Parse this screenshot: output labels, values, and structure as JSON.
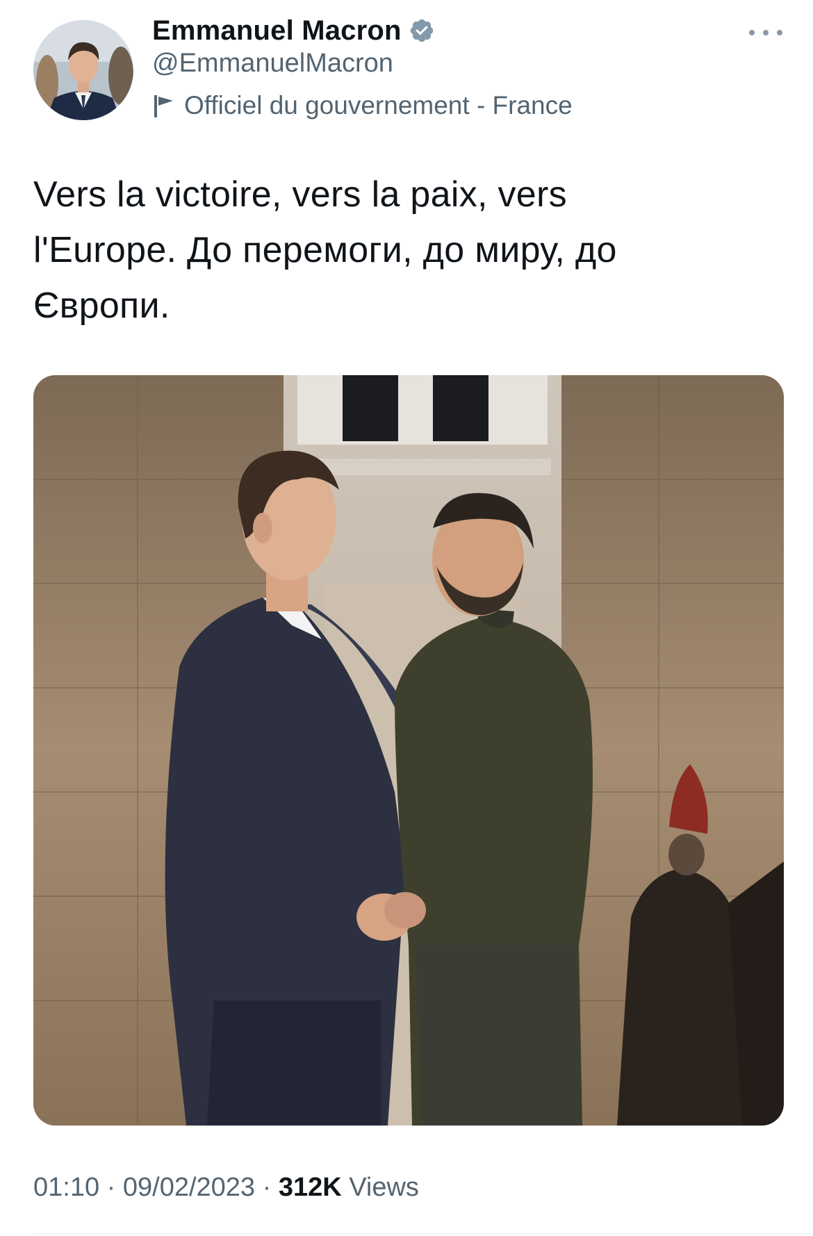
{
  "author": {
    "display_name": "Emmanuel Macron",
    "handle": "@EmmanuelMacron",
    "verified_icon": "verified-badge-icon",
    "label": "Officiel du gouvernement - France",
    "label_icon": "flag-icon"
  },
  "tweet": {
    "text_line1": "Vers la victoire, vers la paix, vers",
    "text_line2": "l'Europe. До перемоги, до миру, до",
    "text_line3": "Європи."
  },
  "meta": {
    "time": "01:10",
    "separator": " · ",
    "date": "09/02/2023",
    "views_count": "312K",
    "views_label": " Views"
  },
  "colors": {
    "primary_text": "#0f1419",
    "secondary_text": "#536471",
    "verified_badge": "#829aab"
  }
}
